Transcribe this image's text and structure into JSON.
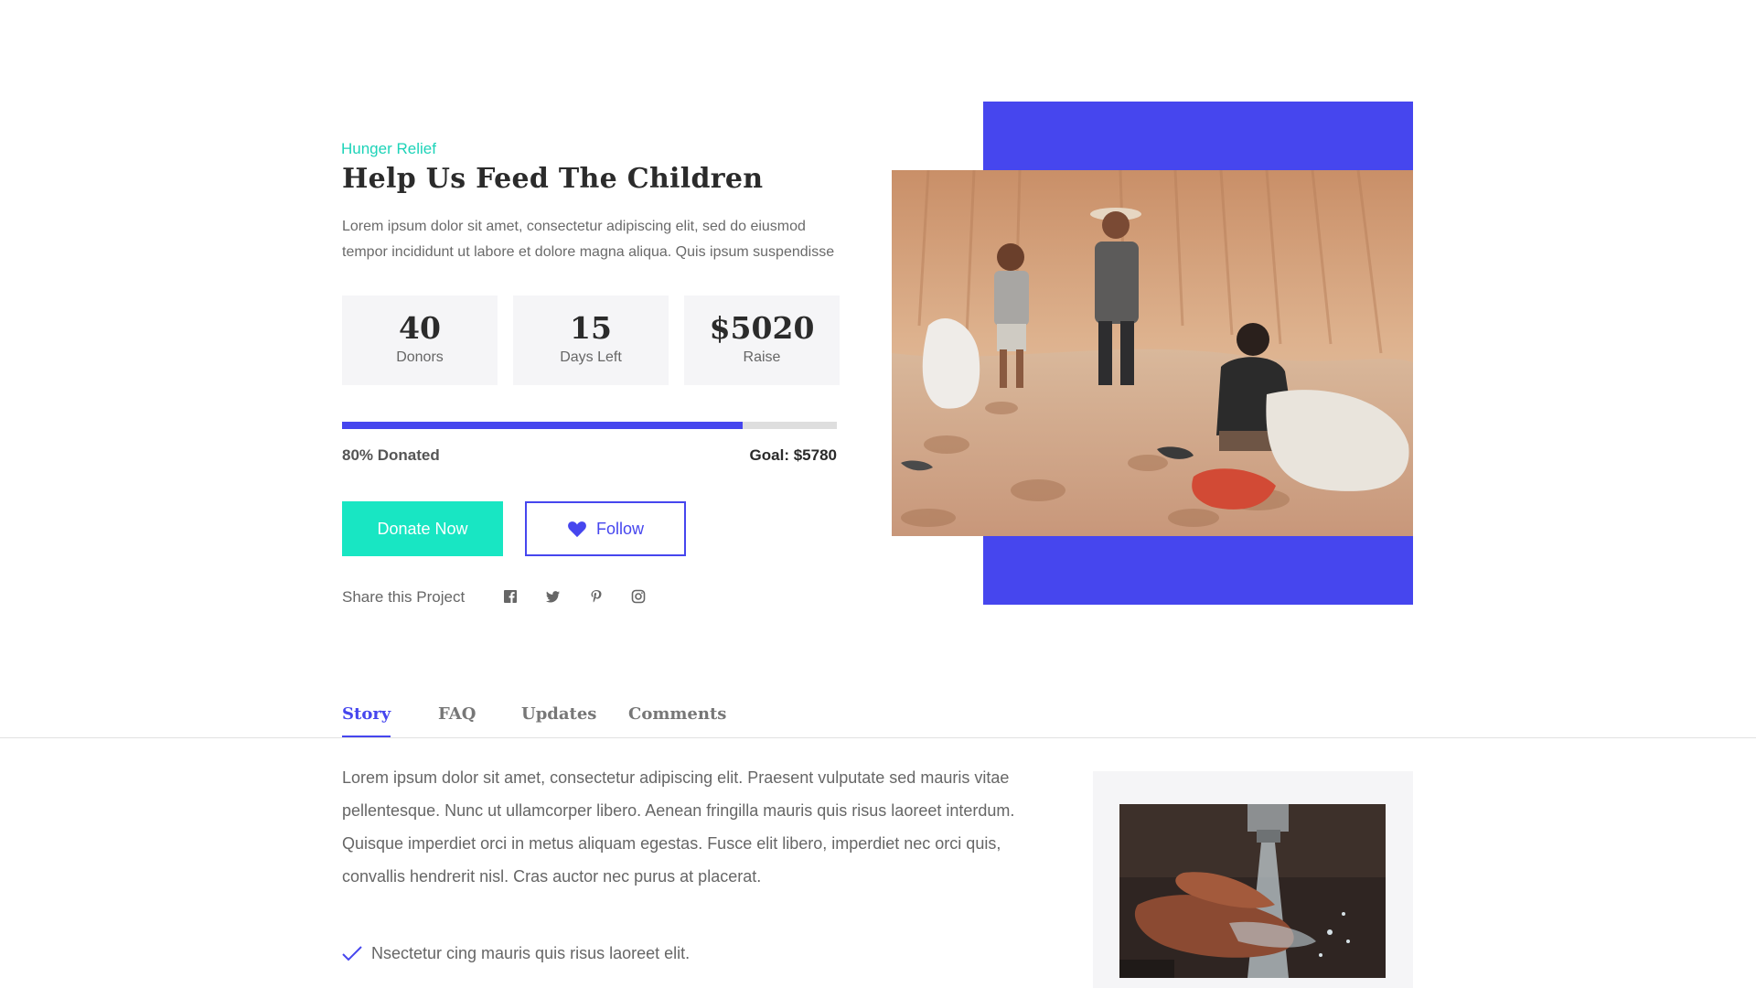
{
  "campaign": {
    "category": "Hunger Relief",
    "title": "Help Us Feed The Children",
    "description": "Lorem ipsum dolor sit amet, consectetur adipiscing elit, sed do eiusmod tempor incididunt ut labore et dolore magna aliqua. Quis ipsum suspendisse"
  },
  "stats": [
    {
      "value": "40",
      "label": "Donors"
    },
    {
      "value": "15",
      "label": "Days Left"
    },
    {
      "value": "$5020",
      "label": "Raise"
    }
  ],
  "progress": {
    "fraction": 0.81,
    "donated_text": "80% Donated",
    "goal_text": "Goal: $5780"
  },
  "actions": {
    "donate_label": "Donate Now",
    "follow_label": "Follow"
  },
  "share": {
    "label": "Share this Project",
    "icons": [
      "facebook-icon",
      "twitter-icon",
      "pinterest-icon",
      "instagram-icon"
    ]
  },
  "tabs": [
    {
      "label": "Story",
      "active": true
    },
    {
      "label": "FAQ",
      "active": false
    },
    {
      "label": "Updates",
      "active": false
    },
    {
      "label": "Comments",
      "active": false
    }
  ],
  "story": {
    "paragraph": "Lorem ipsum dolor sit amet, consectetur adipiscing elit. Praesent vulputate sed mauris vitae pellentesque. Nunc ut ullamcorper libero. Aenean fringilla mauris quis risus laoreet interdum. Quisque imperdiet orci in metus aliquam egestas. Fusce elit libero, imperdiet nec orci quis, convallis hendrerit nisl. Cras auctor nec purus at placerat.",
    "checklist": [
      "Nsectetur cing mauris quis risus laoreet elit."
    ]
  },
  "colors": {
    "accent": "#4646ee",
    "teal": "#18e6c3",
    "category": "#1dd3b8"
  }
}
